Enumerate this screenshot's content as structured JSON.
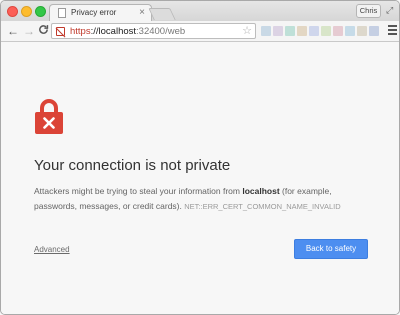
{
  "window": {
    "tab": {
      "title": "Privacy error",
      "close_glyph": "×"
    },
    "profile_name": "Chris",
    "fullscreen_glyph": "⤢"
  },
  "toolbar": {
    "back_glyph": "←",
    "forward_glyph": "→",
    "reload_glyph": "C",
    "url": {
      "scheme": "https",
      "separator": "://",
      "host": "localhost",
      "rest": ":32400/web"
    },
    "star_glyph": "☆",
    "extension_colors": [
      "#c9d9e6",
      "#dcd3e4",
      "#bfe0d8",
      "#e3d7c4",
      "#cfd6ec",
      "#d8e5c9",
      "#e6cbd2",
      "#c6dbe8",
      "#ddd8cc",
      "#c5cfe3"
    ]
  },
  "interstitial": {
    "icon": "lock-error-icon",
    "colors": {
      "lock": "#db4437",
      "button": "#4d8ef0"
    },
    "heading": "Your connection is not private",
    "body_before": "Attackers might be trying to steal your information from ",
    "body_host": "localhost",
    "body_after": " (for example, passwords, messages, or credit cards).",
    "error_code": "NET::ERR_CERT_COMMON_NAME_INVALID",
    "advanced_label": "Advanced",
    "back_button_label": "Back to safety"
  }
}
